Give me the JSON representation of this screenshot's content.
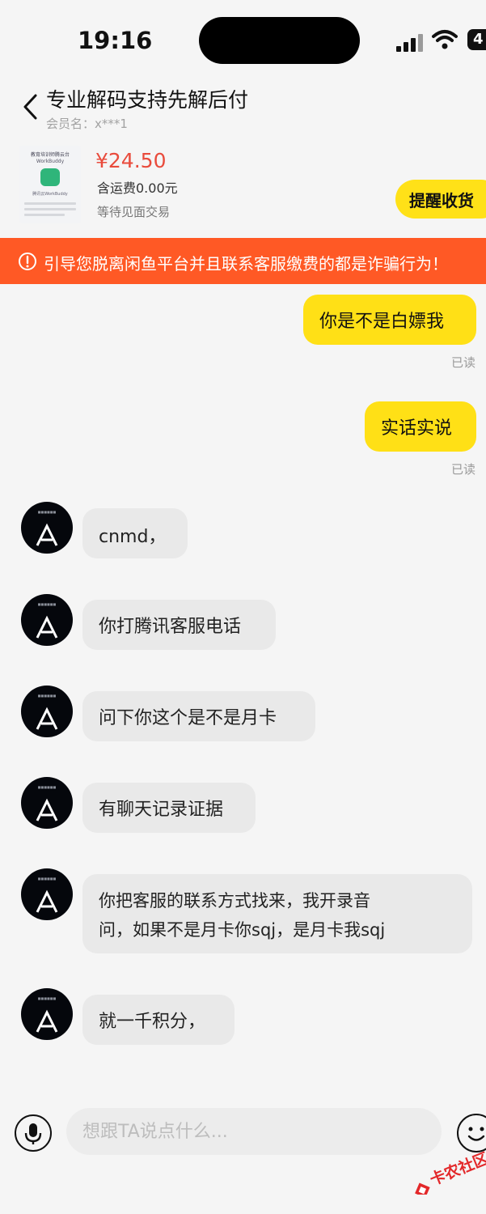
{
  "status_bar": {
    "time": "19:16",
    "battery": "4",
    "icons": [
      "signal-icon",
      "wifi-icon",
      "battery-icon"
    ]
  },
  "header": {
    "title": "专业解码支持先解后付",
    "member_label": "会员名：",
    "member_name": "x***1"
  },
  "product": {
    "thumbnail_text": [
      "教育培训师腾云台",
      "WorkBuddy",
      "腾讯云WorkBuddy"
    ],
    "price": "¥24.50",
    "shipping": "含运费0.00元",
    "status": "等待见面交易",
    "remind_button": "提醒收货"
  },
  "warning": {
    "text": "引导您脱离闲鱼平台并且联系客服缴费的都是诈骗行为！",
    "color": "#ff5925"
  },
  "messages": [
    {
      "from": "me",
      "text": "你是不是白嫖我",
      "read": "已读"
    },
    {
      "from": "me",
      "text": "实话实说",
      "read": "已读"
    },
    {
      "from": "them",
      "text": "cnmd，"
    },
    {
      "from": "them",
      "text": "你打腾讯客服电话"
    },
    {
      "from": "them",
      "text": "问下你这个是不是月卡"
    },
    {
      "from": "them",
      "text": "有聊天记录证据"
    },
    {
      "from": "them",
      "lines": [
        "你把客服的联系方式找来，我开录音",
        "问，如果不是月卡你sqj，是月卡我sqj"
      ]
    },
    {
      "from": "them",
      "text": "就一千积分，"
    }
  ],
  "input": {
    "placeholder": "想跟TA说点什么..."
  },
  "watermark": {
    "text": "卡农社区"
  },
  "colors": {
    "my_bubble": "#ffe016",
    "their_bubble": "#e9e9e9",
    "price": "#e94b3c",
    "remind_button": "#ffe118"
  }
}
